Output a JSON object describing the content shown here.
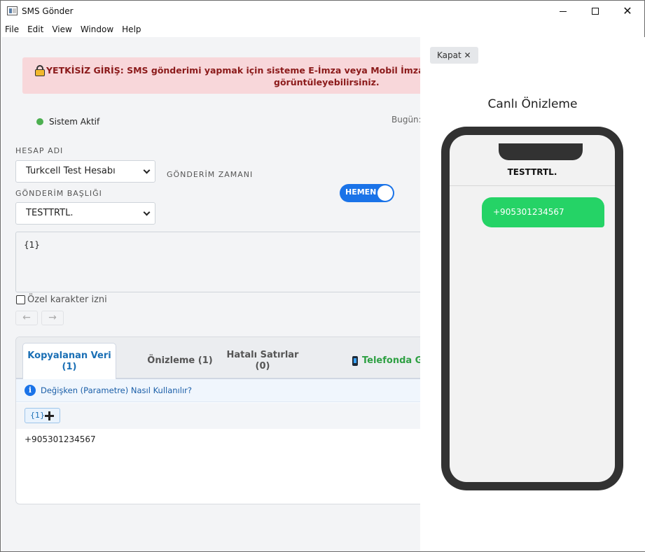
{
  "window": {
    "title": "SMS Gönder",
    "minimize": "—",
    "maximize": "☐",
    "close": "✕"
  },
  "menu": [
    "File",
    "Edit",
    "View",
    "Window",
    "Help"
  ],
  "alert": {
    "prefix": "YETKİSİZ GİRİŞ:",
    "line1": " SMS gönderimi yapmak için sisteme E-İmza veya Mobil İmza ile g",
    "line2": "görüntüleyebilirsiniz."
  },
  "status": {
    "text": "Sistem Aktif",
    "today": "Bugün:"
  },
  "form": {
    "account_label": "HESAP ADI",
    "account_value": "Turkcell Test Hesabı",
    "schedule_label": "GÖNDERİM ZAMANI",
    "header_label": "GÖNDERİM BAŞLIĞI",
    "header_value": "TESTTRTL.",
    "toggle_label": "HEMEN",
    "message": "{1}",
    "special_chars_label": "Özel karakter izni",
    "undo": "←",
    "redo": "→"
  },
  "tabs": [
    {
      "line1": "Kopyalanan Veri",
      "line2": "(1)"
    },
    {
      "line1": "Önizleme (1)"
    },
    {
      "line1": "Hatalı Satırlar",
      "line2": "(0)"
    },
    {
      "line1": "Telefonda Gö"
    }
  ],
  "info": {
    "icon": "i",
    "text": "Değişken (Parametre) Nasıl Kullanılır?"
  },
  "param_chip": "{1}",
  "data_rows": [
    "+905301234567"
  ],
  "preview": {
    "close_label": "Kapat ✕",
    "title": "Canlı Önizleme",
    "sender": "TESTTRTL.",
    "bubble": "+905301234567"
  },
  "colors": {
    "accent": "#1a73e8",
    "alert_bg": "#f8d7da",
    "alert_text": "#8b1a1a",
    "status_green": "#4caf50",
    "bubble_green": "#25d366",
    "phone_frame": "#323232"
  }
}
